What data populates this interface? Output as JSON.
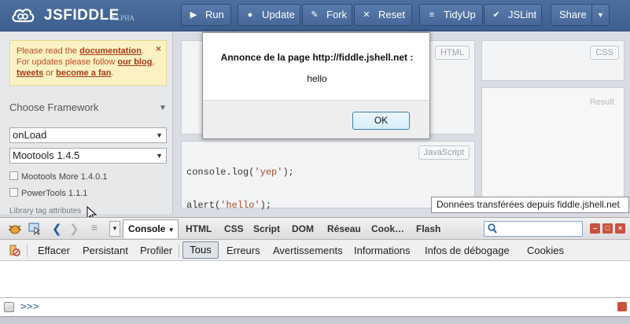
{
  "app": {
    "logo_text": "JSFIDDLE",
    "logo_sub": "ALPHA"
  },
  "toolbar": {
    "run": "Run",
    "update": "Update",
    "fork": "Fork",
    "reset": "Reset",
    "tidyup": "TidyUp",
    "jslint": "JSLint",
    "share": "Share"
  },
  "sidebar": {
    "notice": {
      "line1_pre": "Please read the ",
      "documentation": "documentation",
      "line1_post": ".",
      "line2_pre": "For updates please follow ",
      "our_blog": "our blog",
      "comma": ",",
      "tweets": "tweets",
      "or": " or ",
      "become_fan": "become a fan",
      "end": ".",
      "close": "×"
    },
    "framework_title": "Choose Framework",
    "load_select": "onLoad",
    "framework_select": "Mootools 1.4.5",
    "checkboxes": [
      "Mootools More 1.4.0.1",
      "PowerTools 1.1.1"
    ],
    "library_tag": "Library tag attributes"
  },
  "editors": {
    "html_label": "HTML",
    "css_label": "CSS",
    "result_label": "Result",
    "js_label": "JavaScript",
    "js_line1_a": "console.log(",
    "js_line1_str": "'yep'",
    "js_line1_b": ");",
    "js_line2_a": "alert(",
    "js_line2_str": "'hello'",
    "js_line2_b": ");"
  },
  "dialog": {
    "title": "Annonce de la page http://fiddle.jshell.net :",
    "message": "hello",
    "ok": "OK"
  },
  "tooltip": "Données transférées depuis fiddle.jshell.net",
  "firebug": {
    "tabs": {
      "console": "Console",
      "html": "HTML",
      "css": "CSS",
      "script": "Script",
      "dom": "DOM",
      "reseau": "Réseau",
      "cookies": "Cook…",
      "flash": "Flash"
    },
    "filters": {
      "effacer": "Effacer",
      "persistant": "Persistant",
      "profiler": "Profiler",
      "tous": "Tous",
      "erreurs": "Erreurs",
      "avertissements": "Avertissements",
      "informations": "Informations",
      "debogage": "Infos de débogage",
      "cookies": "Cookies"
    },
    "prompt": ">>>"
  },
  "colors": {
    "header": "#466797",
    "notice_bg": "#fbf2c4",
    "notice_text": "#c04a2a"
  }
}
